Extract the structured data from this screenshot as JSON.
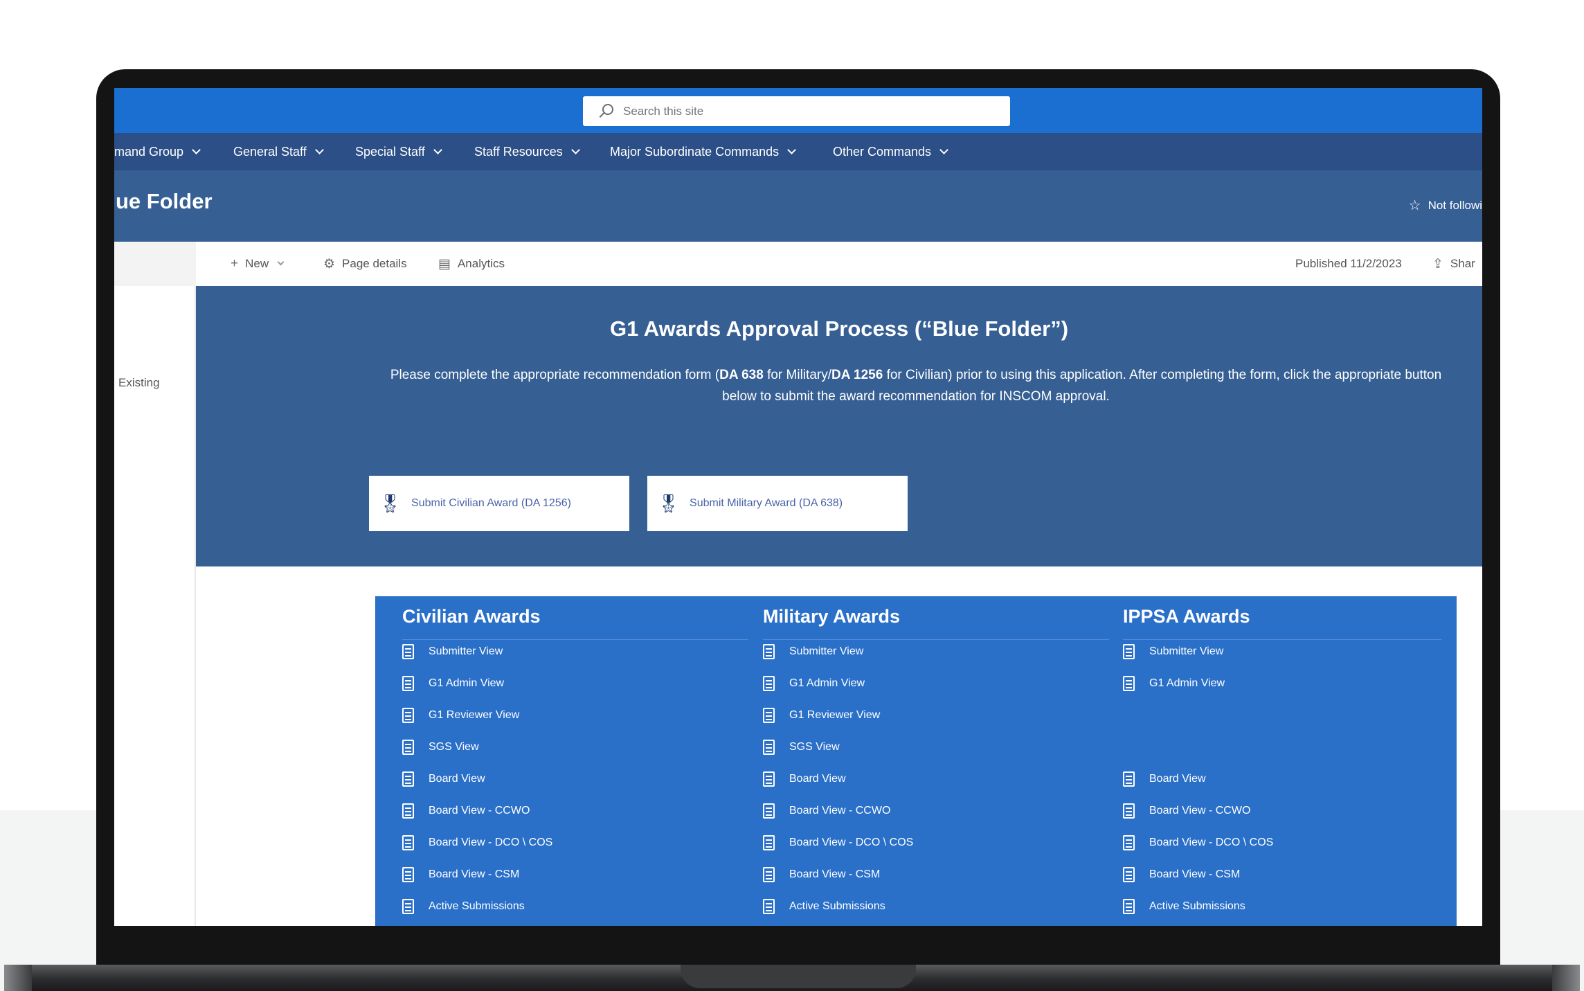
{
  "search": {
    "placeholder": "Search this site"
  },
  "nav": {
    "items": [
      {
        "label": "mand Group"
      },
      {
        "label": "General Staff"
      },
      {
        "label": "Special Staff"
      },
      {
        "label": "Staff Resources"
      },
      {
        "label": "Major Subordinate Commands"
      },
      {
        "label": "Other Commands"
      }
    ]
  },
  "header": {
    "title": "ue Folder",
    "follow_label": "Not followi"
  },
  "commands": {
    "new_label": "New",
    "page_details_label": "Page details",
    "analytics_label": "Analytics",
    "published": "Published 11/2/2023",
    "share_label": "Shar"
  },
  "left_nav": {
    "existing_label": "Existing"
  },
  "hero": {
    "title": "G1 Awards Approval Process (“Blue Folder”)",
    "desc_part1": "Please complete the appropriate recommendation form (",
    "desc_bold1": "DA 638",
    "desc_part2": " for Military/",
    "desc_bold2": "DA 1256",
    "desc_part3": " for Civilian) prior to using this application. After completing the form, click the appropriate button below to submit the award recommendation for INSCOM approval.",
    "buttons": [
      {
        "label": "Submit Civilian Award (DA 1256)"
      },
      {
        "label": "Submit Military Award (DA 638)"
      }
    ]
  },
  "awards": {
    "columns": [
      {
        "title": "Civilian Awards",
        "items": [
          {
            "label": "Submitter View"
          },
          {
            "label": "G1 Admin View"
          },
          {
            "label": "G1 Reviewer View"
          },
          {
            "label": "SGS View"
          },
          {
            "label": "Board View"
          },
          {
            "label": "Board View - CCWO"
          },
          {
            "label": "Board View - DCO \\ COS"
          },
          {
            "label": "Board View - CSM"
          },
          {
            "label": "Active Submissions"
          }
        ]
      },
      {
        "title": "Military Awards",
        "items": [
          {
            "label": "Submitter View"
          },
          {
            "label": "G1 Admin View"
          },
          {
            "label": "G1 Reviewer View"
          },
          {
            "label": "SGS View"
          },
          {
            "label": "Board View"
          },
          {
            "label": "Board View - CCWO"
          },
          {
            "label": "Board View - DCO \\ COS"
          },
          {
            "label": "Board View - CSM"
          },
          {
            "label": "Active Submissions"
          }
        ]
      },
      {
        "title": "IPPSA Awards",
        "items": [
          {
            "label": "Submitter View"
          },
          {
            "label": "G1 Admin View"
          },
          {
            "label": "Board View"
          },
          {
            "label": "Board View - CCWO"
          },
          {
            "label": "Board View - DCO \\ COS"
          },
          {
            "label": "Board View - CSM"
          },
          {
            "label": "Active Submissions"
          }
        ]
      }
    ]
  },
  "colors": {
    "suite_bar": "#1b6fd1",
    "nav_bar": "#2b4f86",
    "title_bar": "#365f94",
    "awards_panel": "#2a70c9"
  }
}
